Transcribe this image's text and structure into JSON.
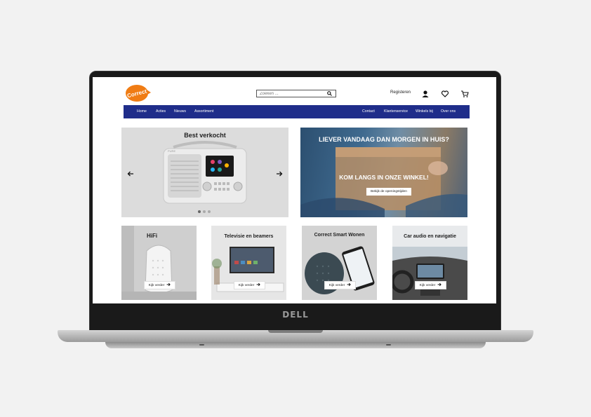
{
  "device": {
    "brand_logo": "DELL"
  },
  "header": {
    "logo_text": "Correct",
    "search_placeholder": "Zoeken ...",
    "register_label": "Registeren"
  },
  "nav": {
    "left": [
      "Home",
      "Acties",
      "Nieuws",
      "Assortiment"
    ],
    "right": [
      "Contact",
      "Klantenservice",
      "Winkels bij",
      "Over ons"
    ]
  },
  "hero_left": {
    "title": "Best verkocht",
    "product_brand": "PURE",
    "carousel_pages": 3,
    "active_page": 1
  },
  "hero_right": {
    "headline": "LIEVER VANDAAG DAN MORGEN IN HUIS?",
    "subline": "KOM LANGS IN ONZE WINKEL!",
    "button_label": "Bekijk de openingstijden"
  },
  "categories": [
    {
      "title": "HiFi",
      "button": "Kijk verder"
    },
    {
      "title": "Televisie en beamers",
      "button": "Kijk verder"
    },
    {
      "title": "Correct Smart Wonen",
      "button": "Kijk verder"
    },
    {
      "title": "Car audio en navigatie",
      "button": "Kijk verder"
    }
  ],
  "colors": {
    "nav_bg": "#1f2d8a",
    "logo_orange": "#f07c14"
  }
}
